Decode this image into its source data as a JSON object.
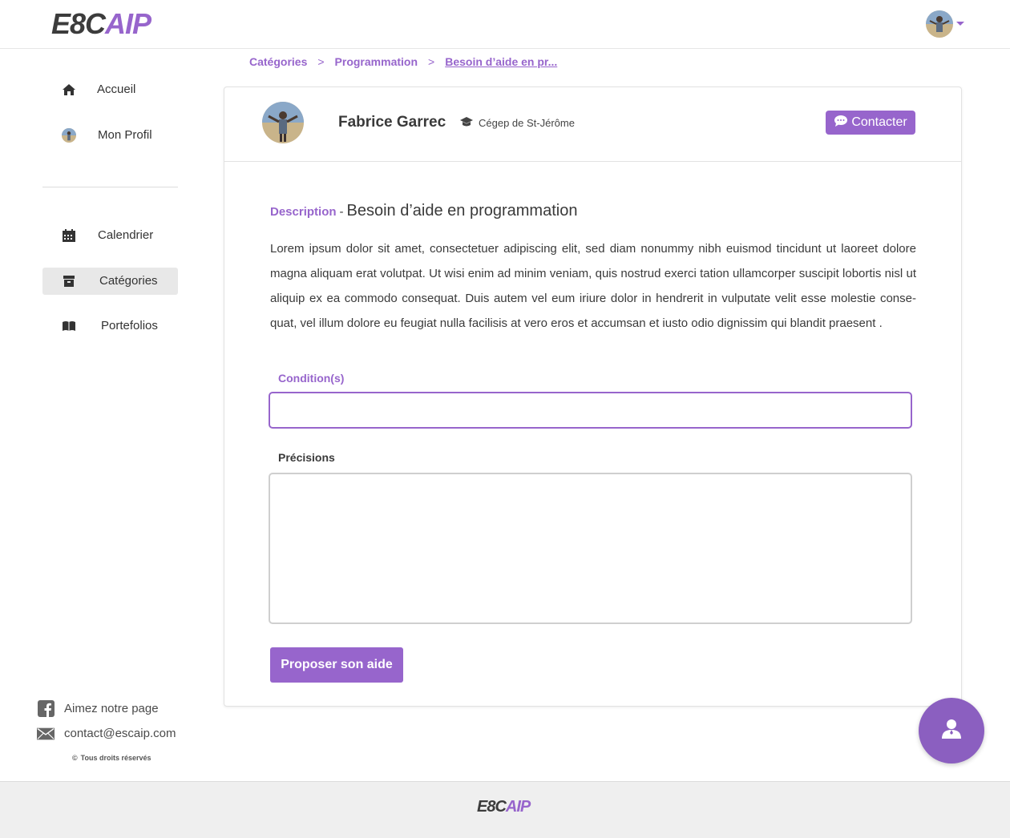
{
  "header": {
    "logo_dark": "E8C",
    "logo_light": "AIP",
    "avatar_icon": "user-avatar"
  },
  "sidebar": {
    "items": [
      {
        "label": "Accueil",
        "icon": "home-icon"
      },
      {
        "label": "Mon Profil",
        "icon": "avatar"
      },
      {
        "label": "Calendrier",
        "icon": "calendar-icon"
      },
      {
        "label": "Catégories",
        "icon": "archive-icon",
        "active": true
      },
      {
        "label": "Portefolios",
        "icon": "book-icon"
      }
    ],
    "facebook": "Aimez notre page",
    "email": "contact@escaip.com",
    "rights": "Tous droits réservés"
  },
  "breadcrumb": {
    "items": [
      "Catégories",
      "Programmation",
      "Besoin d’aide en pr..."
    ],
    "separator": ">"
  },
  "profile": {
    "name": "Fabrice Garrec",
    "school": "Cégep de St-Jérôme",
    "contact_label": "Contacter"
  },
  "request": {
    "description_label": "Description",
    "dash": "-",
    "title": "Besoin d’aide en programmation",
    "body": "Lorem ipsum dolor sit amet, consectetuer adipiscing elit, sed diam nonummy nibh euismod tincidunt ut laoreet dolore magna aliquam erat volutpat. Ut wisi enim ad minim veniam, quis nostrud exerci tation ullamcorper suscipit lobortis nisl ut aliquip ex ea commodo consequat. Duis autem vel eum iriure dolor in hendrerit in vulputate velit esse molestie conse-quat, vel illum dolore eu feugiat nulla facilisis at vero eros et accumsan et iusto odio dignissim qui blandit praesent ."
  },
  "form": {
    "conditions_label": "Condition(s)",
    "conditions_value": "",
    "precisions_label": "Précisions",
    "precisions_value": "",
    "submit_label": "Proposer son aide"
  },
  "colors": {
    "accent": "#9765cc",
    "fab": "#8b5fc0"
  }
}
